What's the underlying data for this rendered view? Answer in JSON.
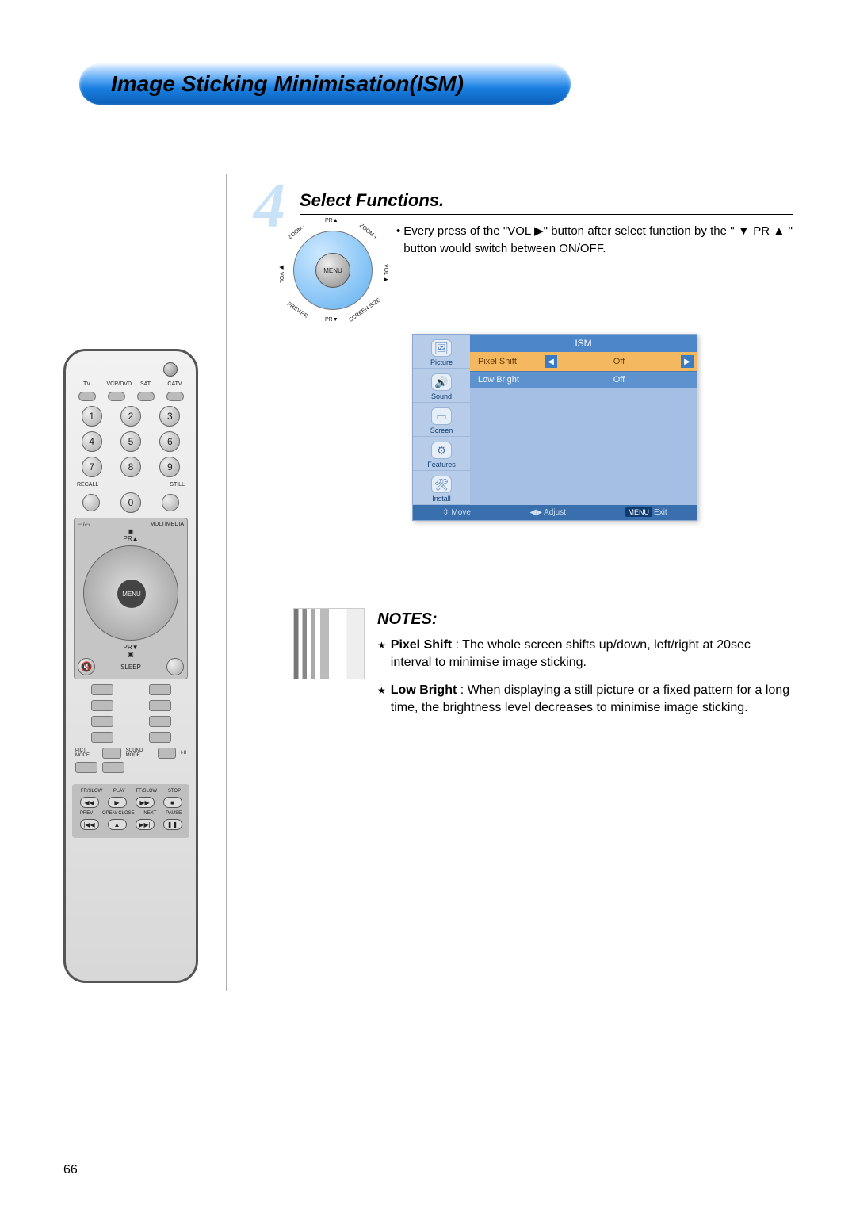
{
  "page_number": "66",
  "title": "Image Sticking Minimisation(ISM)",
  "step": {
    "number": "4",
    "title": "Select Functions.",
    "bullet_prefix": "•",
    "instruction_pre": "Every press of the \"VOL ",
    "instruction_arrow": "▶",
    "instruction_mid": "\" button after select function by the \" ",
    "instruction_pr": "▼ PR ▲",
    "instruction_post": " \" button would switch between ON/OFF."
  },
  "nav_pad": {
    "center": "MENU",
    "top_outer": "PR▲",
    "bottom_outer": "PR▼",
    "top_left": "ZOOM -",
    "top_right": "ZOOM +",
    "left": "◀ VOL",
    "right": "VOL ▶",
    "bottom_left": "PREV.PR",
    "bottom_right": "SCREEN SIZE"
  },
  "osd": {
    "title": "ISM",
    "sidebar": [
      {
        "label": "Picture",
        "glyph": "🖼"
      },
      {
        "label": "Sound",
        "glyph": "🔊"
      },
      {
        "label": "Screen",
        "glyph": "▭"
      },
      {
        "label": "Features",
        "glyph": "⚙"
      },
      {
        "label": "Install",
        "glyph": "🛠"
      }
    ],
    "rows": [
      {
        "name": "Pixel Shift",
        "value": "Off",
        "selected": true
      },
      {
        "name": "Low Bright",
        "value": "Off",
        "selected": false
      }
    ],
    "footer": {
      "move": "Move",
      "adjust": "Adjust",
      "menu_tag": "MENU",
      "exit": "Exit",
      "move_icon": "⇳",
      "adjust_icon": "◀▶"
    }
  },
  "notes": {
    "title": "NOTES:",
    "items": [
      {
        "label": "Pixel Shift",
        "text": " : The whole screen shifts up/down, left/right at 20sec interval to minimise image sticking."
      },
      {
        "label": "Low Bright",
        "text": " : When displaying a still picture or a fixed pattern for a long time, the brightness level decreases to minimise image sticking."
      }
    ]
  },
  "remote": {
    "device_labels": [
      "TV",
      "VCR/DVD",
      "SAT",
      "CATV"
    ],
    "numbers": [
      "1",
      "2",
      "3",
      "4",
      "5",
      "6",
      "7",
      "8",
      "9",
      "0"
    ],
    "row_labels": {
      "recall": "RECALL",
      "still": "STILL",
      "multimedia": "MULTIMEDIA",
      "sleep": "SLEEP",
      "pict_mode": "PICT. MODE",
      "sound_mode": "SOUND MODE",
      "iii": "I·II"
    },
    "nav": {
      "center": "MENU",
      "pr_up": "PR▲",
      "pr_down": "PR▼",
      "zoom_minus": "ZOOM -",
      "zoom_plus": "ZOOM +",
      "vol_l": "◀ VOL",
      "vol_r": "VOL ▶",
      "prev_pr": "PREV.PR",
      "screen_size": "SCREEN SIZE"
    },
    "transport_labels_top": [
      "FR/SLOW",
      "PLAY",
      "FF/SLOW",
      "STOP"
    ],
    "transport_glyphs_top": [
      "◀◀",
      "▶",
      "▶▶",
      "■"
    ],
    "transport_labels_bot": [
      "PREV",
      "OPEN/ CLOSE",
      "NEXT",
      "PAUSE"
    ],
    "transport_glyphs_bot": [
      "|◀◀",
      "▲",
      "▶▶|",
      "❚❚"
    ]
  }
}
